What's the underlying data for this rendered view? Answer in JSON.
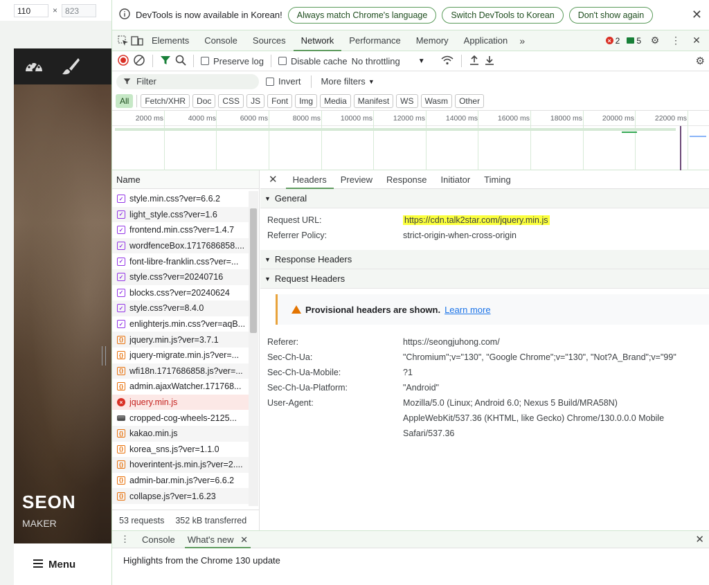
{
  "device": {
    "width": "110",
    "height": "823",
    "x_sep": "×"
  },
  "page": {
    "title_partial": "SEON",
    "subtitle": "MAKER",
    "menu_label": "Menu"
  },
  "infobar": {
    "message": "DevTools is now available in Korean!",
    "btn_match": "Always match Chrome's language",
    "btn_switch": "Switch DevTools to Korean",
    "btn_dont_show": "Don't show again"
  },
  "tabs": [
    "Elements",
    "Console",
    "Sources",
    "Network",
    "Performance",
    "Memory",
    "Application"
  ],
  "tabs_active": "Network",
  "badges": {
    "errors": "2",
    "messages": "5"
  },
  "toolbar": {
    "preserve_log": "Preserve log",
    "disable_cache": "Disable cache",
    "throttling": "No throttling"
  },
  "filter": {
    "placeholder": "Filter",
    "invert": "Invert",
    "more_filters": "More filters"
  },
  "types": [
    "All",
    "Fetch/XHR",
    "Doc",
    "CSS",
    "JS",
    "Font",
    "Img",
    "Media",
    "Manifest",
    "WS",
    "Wasm",
    "Other"
  ],
  "timeline_ticks": [
    "2000 ms",
    "4000 ms",
    "6000 ms",
    "8000 ms",
    "10000 ms",
    "12000 ms",
    "14000 ms",
    "16000 ms",
    "18000 ms",
    "20000 ms",
    "22000 ms"
  ],
  "name_header": "Name",
  "requests": [
    {
      "name": "style.min.css?ver=6.6.2",
      "type": "css"
    },
    {
      "name": "light_style.css?ver=1.6",
      "type": "css"
    },
    {
      "name": "frontend.min.css?ver=1.4.7",
      "type": "css"
    },
    {
      "name": "wordfenceBox.1717686858....",
      "type": "css"
    },
    {
      "name": "font-libre-franklin.css?ver=...",
      "type": "css"
    },
    {
      "name": "style.css?ver=20240716",
      "type": "css"
    },
    {
      "name": "blocks.css?ver=20240624",
      "type": "css"
    },
    {
      "name": "style.css?ver=8.4.0",
      "type": "css"
    },
    {
      "name": "enlighterjs.min.css?ver=aqB...",
      "type": "css"
    },
    {
      "name": "jquery.min.js?ver=3.7.1",
      "type": "js"
    },
    {
      "name": "jquery-migrate.min.js?ver=...",
      "type": "js"
    },
    {
      "name": "wfi18n.1717686858.js?ver=...",
      "type": "js"
    },
    {
      "name": "admin.ajaxWatcher.171768...",
      "type": "js"
    },
    {
      "name": "jquery.min.js",
      "type": "error"
    },
    {
      "name": "cropped-cog-wheels-2125...",
      "type": "img"
    },
    {
      "name": "kakao.min.js",
      "type": "js"
    },
    {
      "name": "korea_sns.js?ver=1.1.0",
      "type": "js"
    },
    {
      "name": "hoverintent-js.min.js?ver=2....",
      "type": "js"
    },
    {
      "name": "admin-bar.min.js?ver=6.6.2",
      "type": "js"
    },
    {
      "name": "collapse.js?ver=1.6.23",
      "type": "js"
    }
  ],
  "summary": {
    "requests": "53 requests",
    "transferred": "352 kB transferred"
  },
  "detail_tabs": [
    "Headers",
    "Preview",
    "Response",
    "Initiator",
    "Timing"
  ],
  "detail_tabs_active": "Headers",
  "general": {
    "title": "General",
    "request_url_key": "Request URL:",
    "request_url": "https://cdn.talk2star.com/jquery.min.js",
    "referrer_policy_key": "Referrer Policy:",
    "referrer_policy": "strict-origin-when-cross-origin"
  },
  "response_headers_title": "Response Headers",
  "request_headers_title": "Request Headers",
  "provisional": {
    "text": "Provisional headers are shown.",
    "link": "Learn more"
  },
  "request_headers": [
    {
      "key": "Referer:",
      "value": "https://seongjuhong.com/"
    },
    {
      "key": "Sec-Ch-Ua:",
      "value": "\"Chromium\";v=\"130\", \"Google Chrome\";v=\"130\", \"Not?A_Brand\";v=\"99\""
    },
    {
      "key": "Sec-Ch-Ua-Mobile:",
      "value": "?1"
    },
    {
      "key": "Sec-Ch-Ua-Platform:",
      "value": "\"Android\""
    },
    {
      "key": "User-Agent:",
      "value": "Mozilla/5.0 (Linux; Android 6.0; Nexus 5 Build/MRA58N)"
    }
  ],
  "user_agent_cont": [
    "AppleWebKit/537.36 (KHTML, like Gecko) Chrome/130.0.0.0 Mobile",
    "Safari/537.36"
  ],
  "drawer": {
    "console": "Console",
    "whats_new": "What's new",
    "highlight": "Highlights from the Chrome 130 update"
  }
}
